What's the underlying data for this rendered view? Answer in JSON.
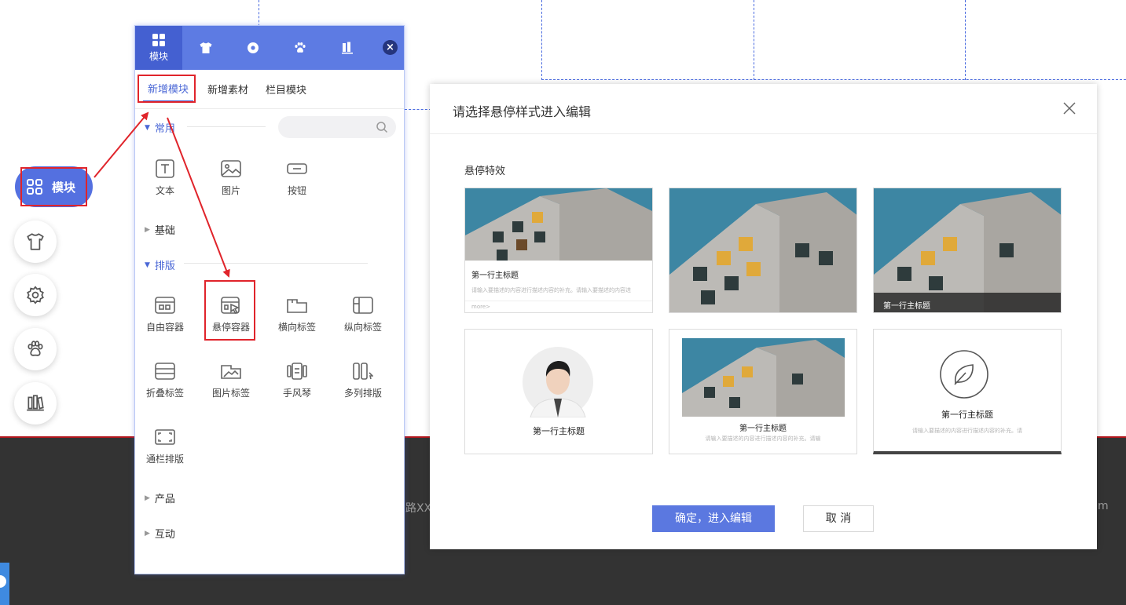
{
  "float_nav": {
    "module_label": "模块"
  },
  "panel": {
    "tabs": [
      {
        "label": "模块",
        "icon": "grid-icon"
      },
      {
        "label": "",
        "icon": "shirt-icon"
      },
      {
        "label": "",
        "icon": "gear-icon"
      },
      {
        "label": "",
        "icon": "paw-icon"
      },
      {
        "label": "",
        "icon": "stack-icon"
      }
    ],
    "close_glyph": "×",
    "subtabs": [
      "新增模块",
      "新增素材",
      "栏目模块"
    ],
    "categories": {
      "common": "常用",
      "basic": "基础",
      "layout": "排版",
      "product": "产品",
      "interaction": "互动"
    },
    "common_items": [
      "文本",
      "图片",
      "按钮"
    ],
    "layout_items": [
      "自由容器",
      "悬停容器",
      "横向标签",
      "纵向标签",
      "折叠标签",
      "图片标签",
      "手风琴",
      "多列排版",
      "通栏排版"
    ]
  },
  "dialog": {
    "title": "请选择悬停样式进入编辑",
    "section": "悬停特效",
    "card_title": "第一行主标题",
    "card1_desc": "请输入要描述的内容进行描述内容的补充。请输入要描述的内容进",
    "card1_more": "more>",
    "card5_desc": "请输入要描述的内容进行描述内容的补充。请输",
    "card6_desc": "请输入要描述的内容进行描述内容的补充。请",
    "confirm": "确定，进入编辑",
    "cancel": "取 消"
  },
  "footer": {
    "text_left": "路XX",
    "text_right": "m"
  },
  "colors": {
    "accent": "#5b78e0",
    "panel_header": "#5d7be3",
    "highlight": "#e0242b",
    "footer": "#333333"
  }
}
